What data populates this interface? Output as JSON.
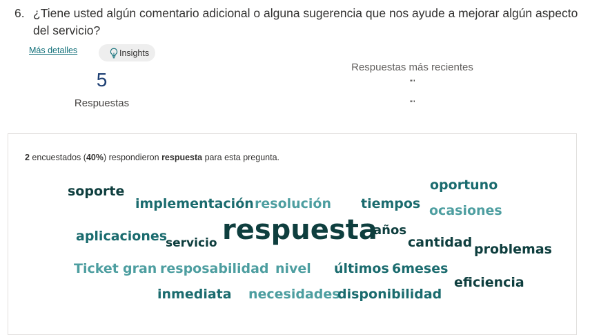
{
  "question": {
    "number": "6.",
    "text": "¿Tiene usted algún comentario adicional o alguna sugerencia que nos ayude a mejorar algún aspecto del servicio?"
  },
  "actions": {
    "more_details": "Más detalles",
    "insights": "Insights",
    "insights_icon": "lightbulb-icon"
  },
  "responses": {
    "count": "5",
    "label": "Respuestas"
  },
  "recent": {
    "title": "Respuestas más recientes",
    "items": [
      "\"\"",
      "\"\""
    ]
  },
  "summary": {
    "respondents": "2",
    "text1": " encuestados (",
    "percent": "40%",
    "text2": ") respondieron ",
    "keyword": "respuesta",
    "text3": " para esta pregunta."
  },
  "word_cloud": {
    "words": [
      {
        "text": "soporte",
        "tone": "dark"
      },
      {
        "text": "implementación",
        "tone": "mid"
      },
      {
        "text": "resolución",
        "tone": "light"
      },
      {
        "text": "tiempos",
        "tone": "mid"
      },
      {
        "text": "oportuno",
        "tone": "mid"
      },
      {
        "text": "ocasiones",
        "tone": "light"
      },
      {
        "text": "aplicaciones",
        "tone": "mid"
      },
      {
        "text": "servicio",
        "tone": "dark"
      },
      {
        "text": "respuesta",
        "tone": "dark"
      },
      {
        "text": "años",
        "tone": "dark"
      },
      {
        "text": "cantidad",
        "tone": "dark"
      },
      {
        "text": "problemas",
        "tone": "dark"
      },
      {
        "text": "Ticket",
        "tone": "light"
      },
      {
        "text": "gran",
        "tone": "light"
      },
      {
        "text": "resposabilidad",
        "tone": "light"
      },
      {
        "text": "nivel",
        "tone": "light"
      },
      {
        "text": "últimos",
        "tone": "mid"
      },
      {
        "text": "6meses",
        "tone": "mid"
      },
      {
        "text": "eficiencia",
        "tone": "dark"
      },
      {
        "text": "inmediata",
        "tone": "mid"
      },
      {
        "text": "necesidades",
        "tone": "light"
      },
      {
        "text": "disponibilidad",
        "tone": "mid"
      }
    ]
  },
  "colors": {
    "word_dark": "#0e3e3e",
    "word_mid": "#1a6b6e",
    "word_light": "#4d9ea0",
    "link": "#0f6e78",
    "count": "#1d3f73"
  }
}
